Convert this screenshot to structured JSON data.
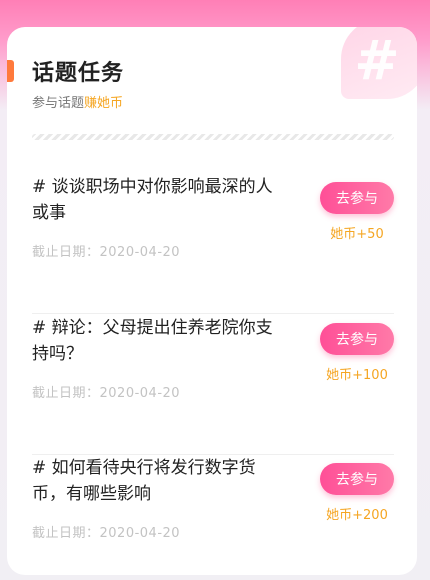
{
  "header": {
    "title": "话题任务",
    "subtitle_prefix": "参与话题",
    "subtitle_highlight": "赚她币",
    "deco_icon": "#"
  },
  "tasks": [
    {
      "title": "# 谈谈职场中对你影响最深的人或事",
      "date": "截止日期：2020-04-20",
      "button": "去参与",
      "reward": "她币+50"
    },
    {
      "title": "# 辩论：父母提出住养老院你支持吗？",
      "date": "截止日期：2020-04-20",
      "button": "去参与",
      "reward": "她币+100"
    },
    {
      "title": "# 如何看待央行将发行数字货币，有哪些影响",
      "date": "截止日期：2020-04-20",
      "button": "去参与",
      "reward": "她币+200"
    }
  ],
  "colors": {
    "accent": "#ff7a3c",
    "button": "#ff4f97",
    "reward": "#f5a623"
  }
}
